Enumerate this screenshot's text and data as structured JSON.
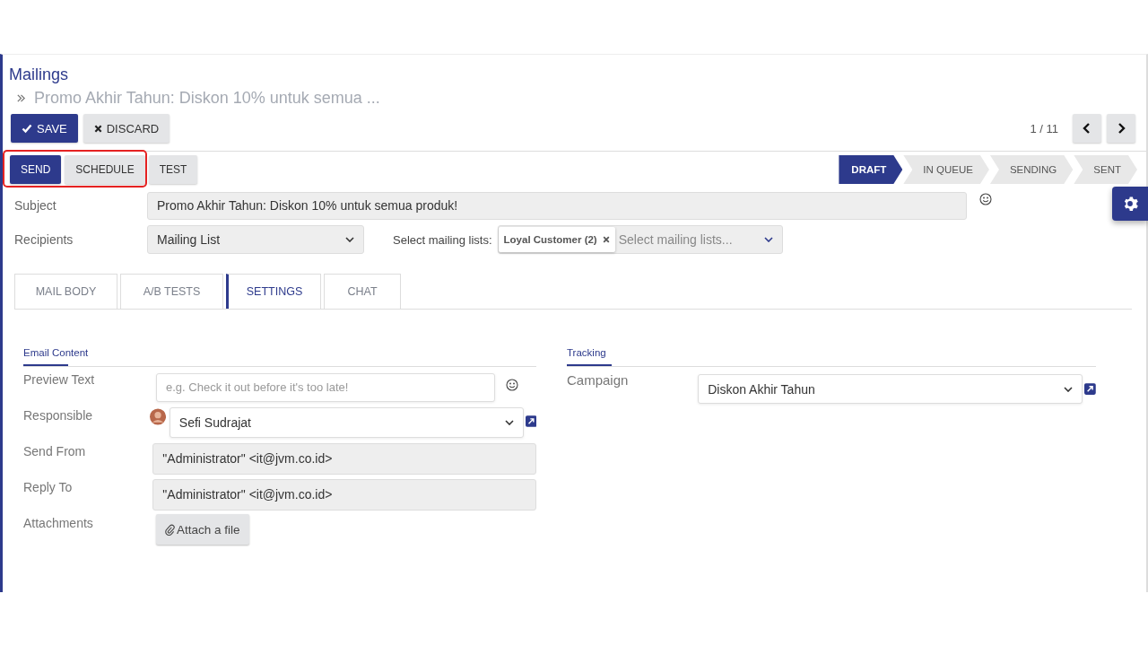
{
  "breadcrumb": {
    "title": "Mailings",
    "record": "Promo Akhir Tahun: Diskon 10% untuk semua ..."
  },
  "actions": [
    {
      "label": "SAVE",
      "kind": "primary"
    },
    {
      "label": "DISCARD",
      "kind": "secondary"
    }
  ],
  "pager": "1 / 11",
  "buttons": [
    {
      "label": "SEND",
      "kind": "primary"
    },
    {
      "label": "SCHEDULE",
      "kind": "secondary"
    },
    {
      "label": "TEST",
      "kind": "secondary"
    }
  ],
  "highlight_frame": true,
  "stages": [
    {
      "label": "DRAFT",
      "selected": true
    },
    {
      "label": "IN QUEUE",
      "selected": false
    },
    {
      "label": "SENDING",
      "selected": false
    },
    {
      "label": "SENT",
      "selected": false
    }
  ],
  "subject": {
    "label": "Subject",
    "value": "Promo Akhir Tahun: Diskon 10% untuk semua produk!"
  },
  "recipients": {
    "label": "Recipients",
    "value": "Mailing List",
    "lists_label": "Select mailing lists:",
    "tags": [
      "Loyal Customer (2)"
    ],
    "placeholder": "Select mailing lists..."
  },
  "tabs": [
    {
      "label": "MAIL BODY",
      "selected": false
    },
    {
      "label": "A/B TESTS",
      "selected": false
    },
    {
      "label": "SETTINGS",
      "selected": true
    },
    {
      "label": "CHAT",
      "selected": false
    }
  ],
  "email_content": {
    "title": "Email Content",
    "fields": [
      {
        "kind": "text",
        "label": "Preview Text",
        "placeholder": "e.g. Check it out before it's too late!"
      },
      {
        "kind": "user",
        "label": "Responsible",
        "value": "Sefi Sudrajat"
      },
      {
        "kind": "readonly",
        "label": "Send From",
        "value": "\"Administrator\" <it@jvm.co.id>"
      },
      {
        "kind": "readonly",
        "label": "Reply To",
        "value": "\"Administrator\" <it@jvm.co.id>"
      },
      {
        "kind": "file",
        "label": "Attachments",
        "value": "Attach a file"
      }
    ]
  },
  "tracking": {
    "title": "Tracking",
    "fields": [
      {
        "kind": "select",
        "label": "Campaign",
        "value": "Diskon Akhir Tahun"
      }
    ]
  }
}
